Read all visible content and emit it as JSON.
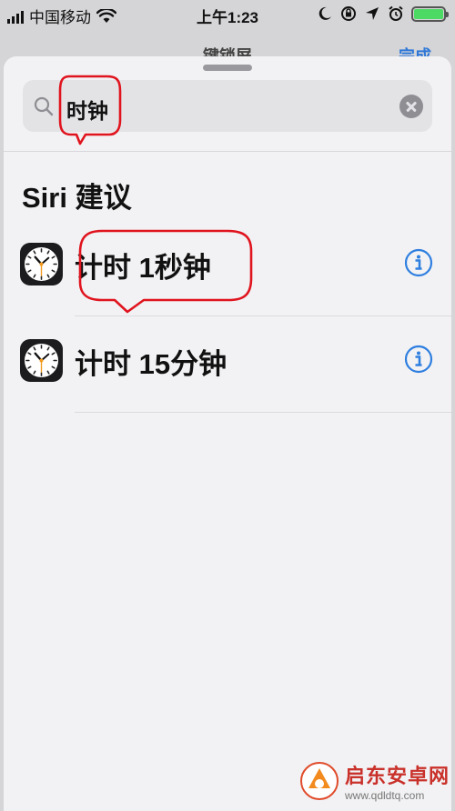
{
  "status_bar": {
    "carrier": "中国移动",
    "time": "上午1:23",
    "battery_color": "#4cd964"
  },
  "behind_header": {
    "title": "键锁屏",
    "done_label": "完成",
    "accent": "#2f78d8"
  },
  "search": {
    "value": "时钟",
    "icon": "search-icon",
    "clear_icon": "clear-icon"
  },
  "section": {
    "title": "Siri 建议"
  },
  "suggestions": [
    {
      "label": "计时 1秒钟",
      "icon": "clock-icon",
      "action_icon": "info-icon"
    },
    {
      "label": "计时 15分钟",
      "icon": "clock-icon",
      "action_icon": "info-icon"
    }
  ],
  "watermark": {
    "name": "启东安卓网",
    "url": "www.qdldtq.com"
  },
  "colors": {
    "callout": "#e0141e",
    "info": "#2f7fe0"
  }
}
